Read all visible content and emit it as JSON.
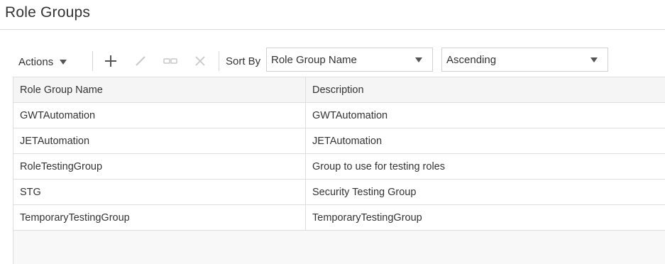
{
  "page": {
    "title": "Role Groups"
  },
  "toolbar": {
    "actions_label": "Actions",
    "icons": {
      "add": "plus-icon",
      "edit": "pencil-icon",
      "link": "link-icon",
      "delete": "close-icon"
    },
    "sort_by_label": "Sort By",
    "sort_field": "Role Group Name",
    "sort_order": "Ascending"
  },
  "table": {
    "columns": [
      "Role Group Name",
      "Description"
    ],
    "rows": [
      {
        "name": "GWTAutomation",
        "description": "GWTAutomation"
      },
      {
        "name": "JETAutomation",
        "description": "JETAutomation"
      },
      {
        "name": "RoleTestingGroup",
        "description": "Group to use for testing roles"
      },
      {
        "name": "STG",
        "description": "Security Testing Group"
      },
      {
        "name": "TemporaryTestingGroup",
        "description": "TemporaryTestingGroup"
      }
    ]
  },
  "colors": {
    "text": "#333333",
    "disabled_icon": "#c8c8c8",
    "border": "#dedede",
    "header_bg": "#f5f5f5"
  }
}
